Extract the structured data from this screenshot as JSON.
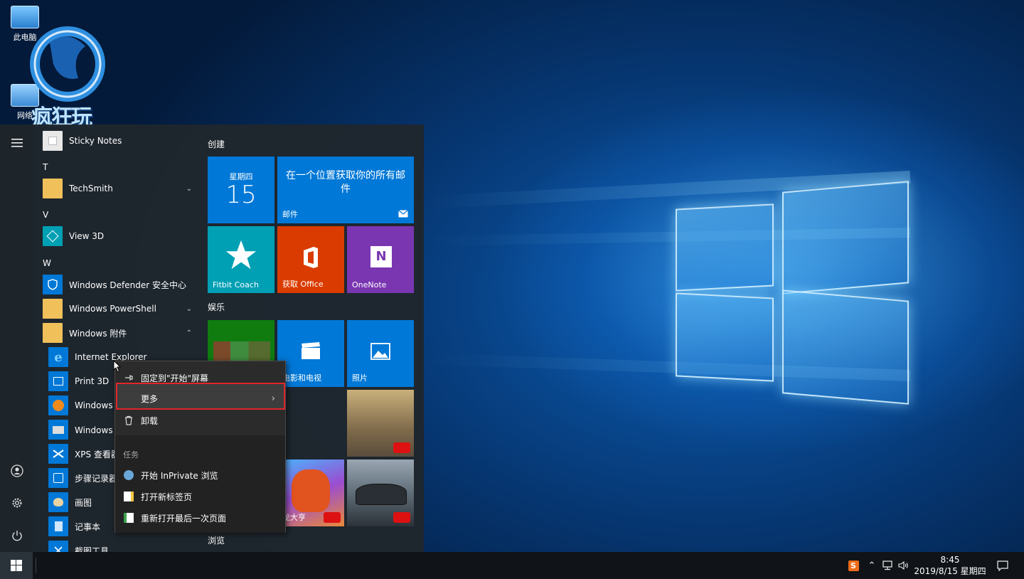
{
  "desktop": {
    "icons": [
      {
        "label": "此电脑"
      },
      {
        "label": "网络"
      }
    ],
    "watermark_text": "疯狂玩"
  },
  "start_menu": {
    "rail": {
      "menu_icon": "hamburger-icon",
      "user_icon": "user-icon",
      "settings_icon": "gear-icon",
      "power_icon": "power-icon"
    },
    "apps": [
      {
        "type": "app",
        "label": "Sticky Notes",
        "icon": "sticky-notes-icon"
      },
      {
        "type": "letter",
        "label": "T"
      },
      {
        "type": "folder",
        "label": "TechSmith",
        "expanded": false
      },
      {
        "type": "letter",
        "label": "V"
      },
      {
        "type": "app",
        "label": "View 3D",
        "icon": "cube-icon"
      },
      {
        "type": "letter",
        "label": "W"
      },
      {
        "type": "app",
        "label": "Windows Defender 安全中心",
        "icon": "shield-icon"
      },
      {
        "type": "folder",
        "label": "Windows PowerShell",
        "expanded": false
      },
      {
        "type": "folder",
        "label": "Windows 附件",
        "expanded": true
      },
      {
        "type": "sub",
        "label": "Internet Explorer",
        "icon": "ie-icon"
      },
      {
        "type": "sub",
        "label": "Print 3D",
        "icon": "print3d-icon"
      },
      {
        "type": "sub",
        "label": "Windows M",
        "icon": "media-player-icon"
      },
      {
        "type": "sub",
        "label": "Windows 传",
        "icon": "fax-icon"
      },
      {
        "type": "sub",
        "label": "XPS 查看器",
        "icon": "xps-icon"
      },
      {
        "type": "sub",
        "label": "步骤记录器",
        "icon": "steps-recorder-icon"
      },
      {
        "type": "sub",
        "label": "画图",
        "icon": "paint-icon"
      },
      {
        "type": "sub",
        "label": "记事本",
        "icon": "notepad-icon"
      },
      {
        "type": "sub",
        "label": "截图工具",
        "icon": "snipping-icon"
      }
    ],
    "groups": {
      "create": "创建",
      "entertainment": "娱乐",
      "browse": "浏览"
    },
    "tiles": {
      "calendar": {
        "day": "星期四",
        "date": "15"
      },
      "mail": {
        "headline": "在一个位置获取你的所有邮件",
        "label": "邮件"
      },
      "fitbit": {
        "label": "Fitbit Coach"
      },
      "office": {
        "label": "获取 Office"
      },
      "onenote": {
        "label": "OneNote"
      },
      "movies": {
        "label": "电影和电视"
      },
      "photos": {
        "label": "照片"
      },
      "game_dragon": {
        "label": "龙大亨"
      }
    }
  },
  "context_menu": {
    "pin": "固定到\"开始\"屏幕",
    "more": "更多",
    "uninstall": "卸载",
    "tasks_header": "任务",
    "task_inprivate": "开始 InPrivate 浏览",
    "task_new_tab": "打开新标签页",
    "task_reopen": "重新打开最后一次页面"
  },
  "taskbar": {
    "time": "8:45",
    "date": "2019/8/15 星期四",
    "sougou_label": "S"
  },
  "colors": {
    "tile_blue": "#0078d7",
    "tile_teal": "#00a0b4",
    "tile_orange": "#da3b01",
    "tile_purple": "#7a36b1",
    "highlight_red": "#e0262b"
  }
}
